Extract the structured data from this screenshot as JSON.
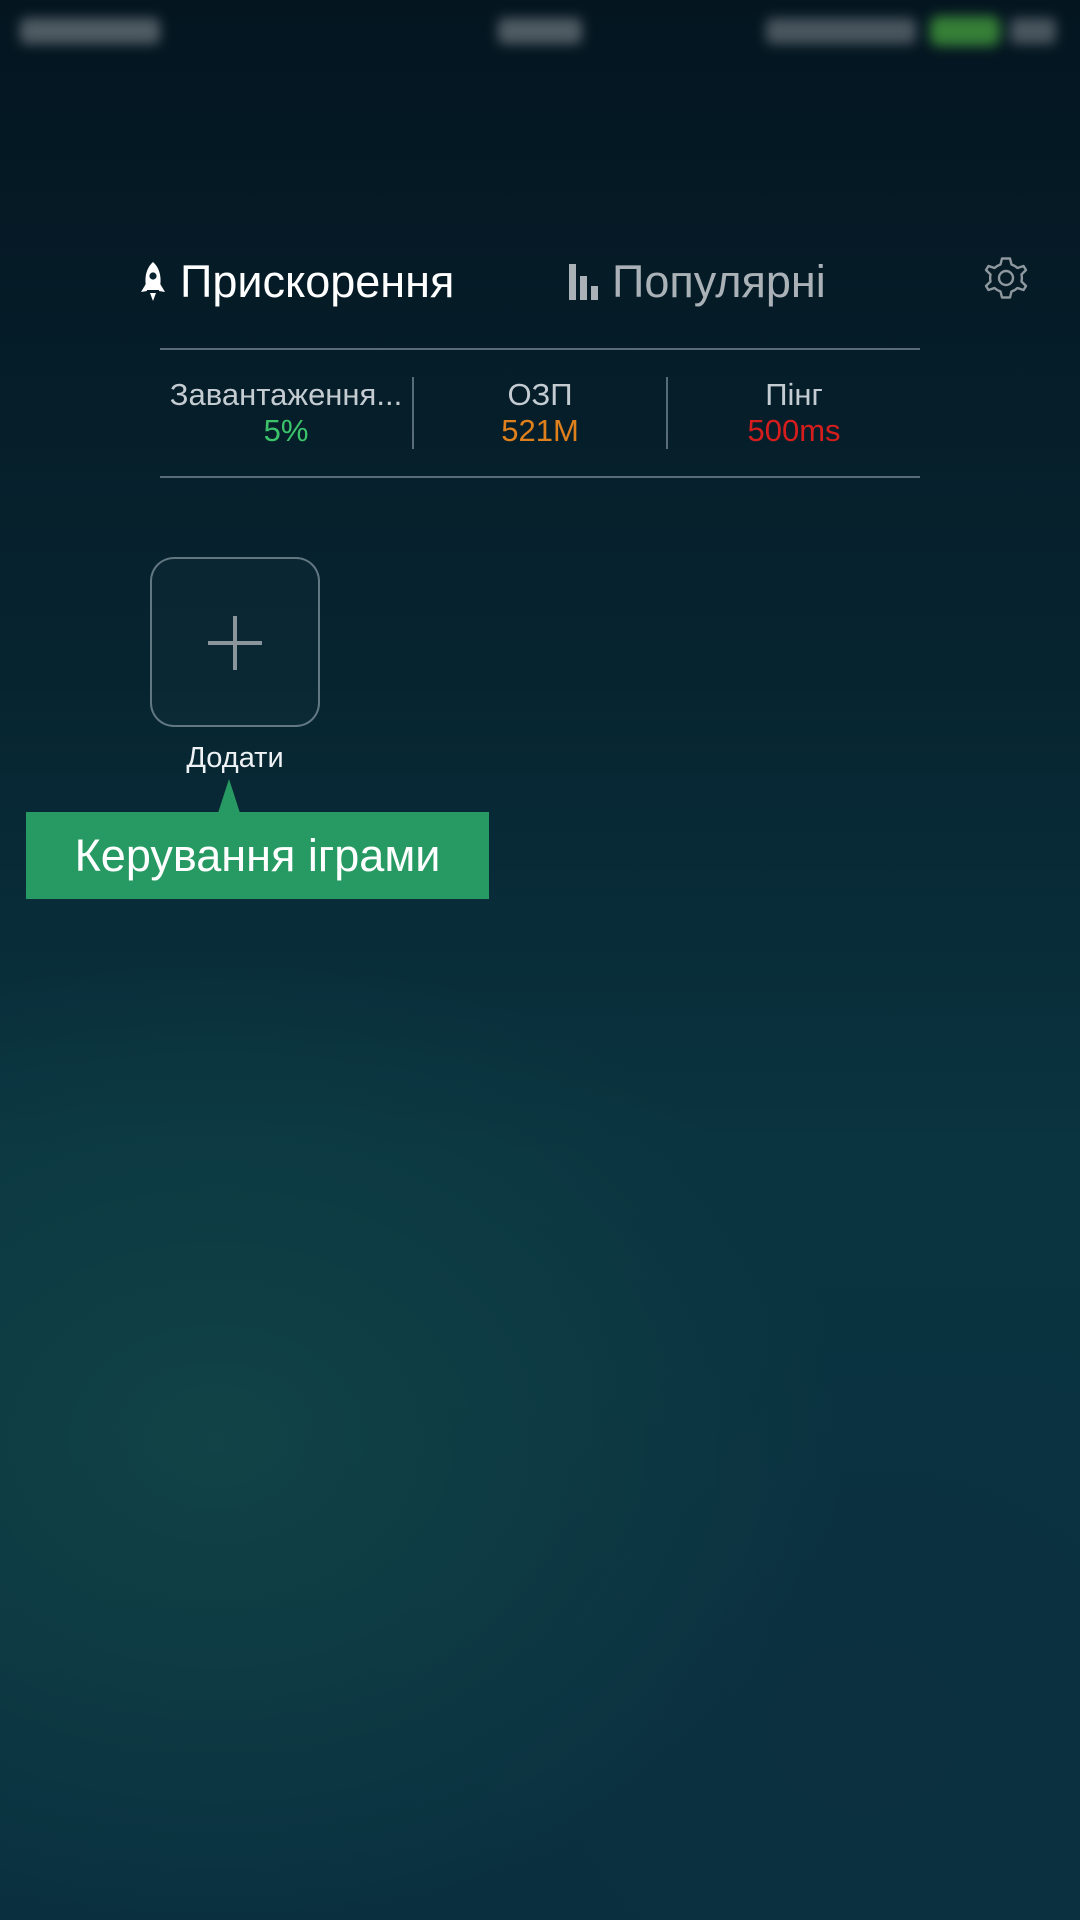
{
  "tabs": [
    {
      "label": "Прискорення",
      "icon": "rocket-icon",
      "active": true
    },
    {
      "label": "Популярні",
      "icon": "bar-chart-icon",
      "active": false
    }
  ],
  "settings": {
    "icon": "gear-icon"
  },
  "stats": [
    {
      "label": "Завантаження...",
      "value": "5%",
      "color": "#3cc36a"
    },
    {
      "label": "ОЗП",
      "value": "521M",
      "color": "#e0801c"
    },
    {
      "label": "Пінг",
      "value": "500ms",
      "color": "#d51d1d"
    }
  ],
  "add_tile": {
    "label": "Додати",
    "icon": "plus-icon"
  },
  "tooltip": {
    "text": "Керування іграми",
    "color": "#269a62"
  }
}
